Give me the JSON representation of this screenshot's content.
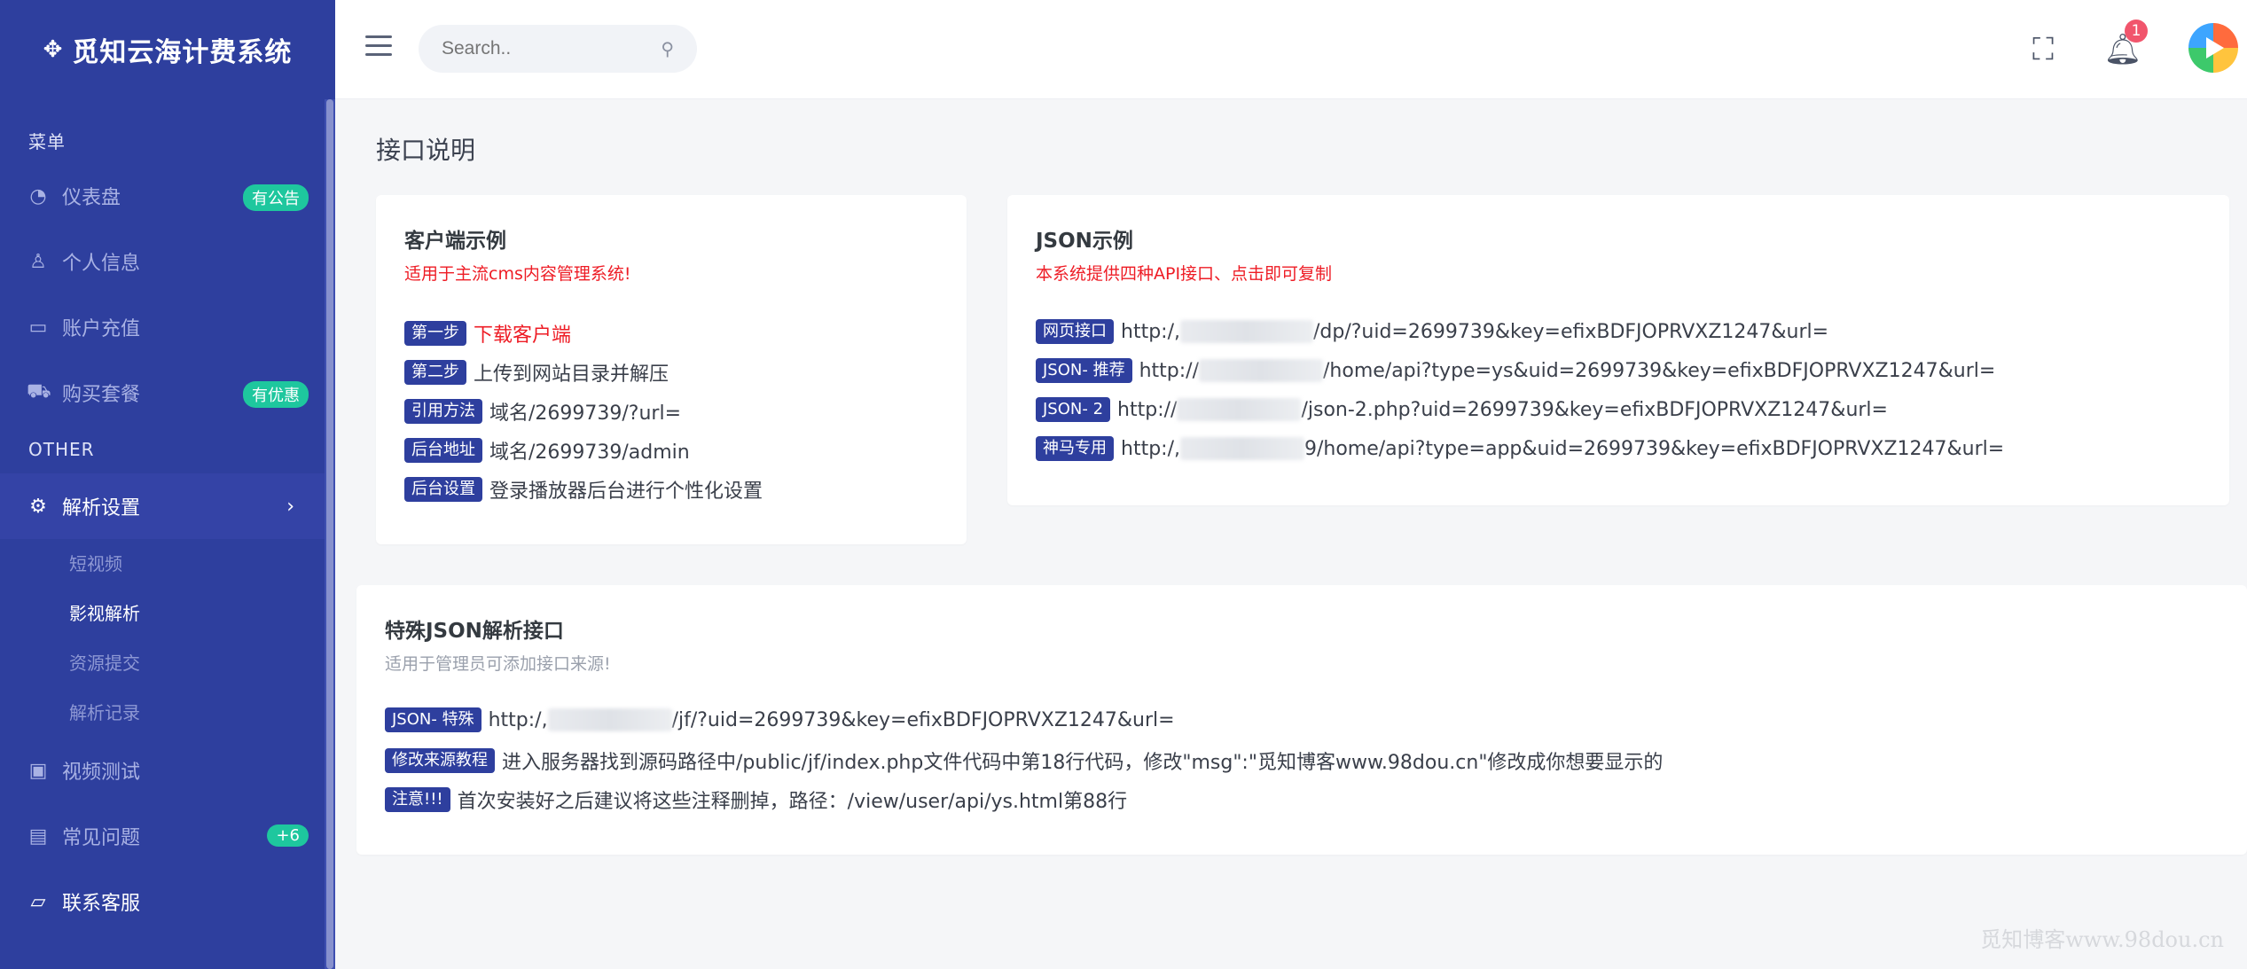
{
  "sidebar": {
    "brand": "觅知云海计费系统",
    "section_menu": "菜单",
    "section_other": "OTHER",
    "items": [
      {
        "label": "仪表盘",
        "icon": "dashboard-icon",
        "badge": "有公告"
      },
      {
        "label": "个人信息",
        "icon": "user-icon"
      },
      {
        "label": "账户充值",
        "icon": "card-icon"
      },
      {
        "label": "购买套餐",
        "icon": "cart-icon",
        "badge": "有优惠"
      },
      {
        "label": "解析设置",
        "icon": "gear-icon"
      },
      {
        "label": "视频测试",
        "icon": "video-icon"
      },
      {
        "label": "常见问题",
        "icon": "document-icon",
        "badge": "+6"
      },
      {
        "label": "联系客服",
        "icon": "chat-icon"
      }
    ],
    "subitems": [
      "短视频",
      "影视解析",
      "资源提交",
      "解析记录"
    ]
  },
  "topbar": {
    "search_placeholder": "Search..",
    "notification_count": "1"
  },
  "page": {
    "title": "接口说明"
  },
  "client_card": {
    "title": "客户端示例",
    "subtitle": "适用于主流cms内容管理系统!",
    "rows": [
      {
        "tag": "第一步",
        "text": "下载客户端"
      },
      {
        "tag": "第二步",
        "text": "上传到网站目录并解压"
      },
      {
        "tag": "引用方法",
        "text": "域名/2699739/?url="
      },
      {
        "tag": "后台地址",
        "text": "域名/2699739/admin"
      },
      {
        "tag": "后台设置",
        "text": "登录播放器后台进行个性化设置"
      }
    ]
  },
  "json_card": {
    "title": "JSON示例",
    "subtitle": "本系统提供四种API接口、点击即可复制",
    "rows": [
      {
        "tag": "网页接口",
        "prefix": "http:/,",
        "suffix": "/dp/?uid=2699739&key=efixBDFJOPRVXZ1247&url="
      },
      {
        "tag": "JSON- 推荐",
        "prefix": "http://",
        "suffix": "/home/api?type=ys&uid=2699739&key=efixBDFJOPRVXZ1247&url="
      },
      {
        "tag": "JSON- 2",
        "prefix": "http://",
        "suffix": "/json-2.php?uid=2699739&key=efixBDFJOPRVXZ1247&url="
      },
      {
        "tag": "神马专用",
        "prefix": "http:/,",
        "suffix": "9/home/api?type=app&uid=2699739&key=efixBDFJOPRVXZ1247&url="
      }
    ]
  },
  "special_card": {
    "title": "特殊JSON解析接口",
    "subtitle": "适用于管理员可添加接口来源!",
    "rows": [
      {
        "tag": "JSON- 特殊",
        "prefix": "http:/,",
        "suffix": "/jf/?uid=2699739&key=efixBDFJOPRVXZ1247&url="
      },
      {
        "tag": "修改来源教程",
        "text": "进入服务器找到源码路径中/public/jf/index.php文件代码中第18行代码，修改\"msg\":\"觅知博客www.98dou.cn\"修改成你想要显示的"
      },
      {
        "tag": "注意!!!",
        "text": "首次安装好之后建议将这些注释删掉，路径：/view/user/api/ys.html第88行"
      }
    ]
  },
  "watermark": "觅知博客www.98dou.cn",
  "colors": {
    "sidebar": "#2e3f9e",
    "accent_red": "#ee1c25",
    "badge_green": "#1ec79e",
    "notify_red": "#f1556c"
  }
}
